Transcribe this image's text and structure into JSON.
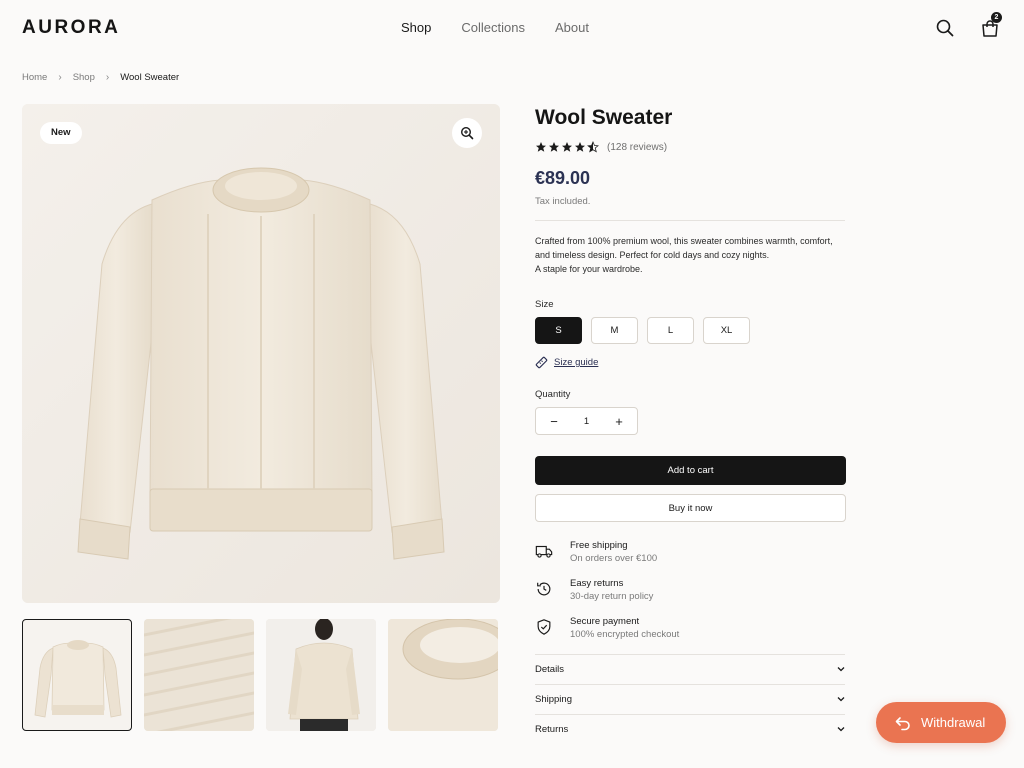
{
  "header": {
    "logo": "AURORA",
    "nav": [
      {
        "label": "Shop",
        "active": true
      },
      {
        "label": "Collections",
        "active": false
      },
      {
        "label": "About",
        "active": false
      }
    ],
    "search_icon": "search-icon",
    "bag_icon": "shopping-bag-icon",
    "bag_count": "2"
  },
  "breadcrumb": {
    "items": [
      "Home",
      "Shop"
    ],
    "current": "Wool Sweater"
  },
  "gallery": {
    "badge": "New",
    "zoom_icon": "zoom-in-icon",
    "thumbnails": [
      "front",
      "knit-detail",
      "model-back",
      "collar-detail"
    ],
    "selected_thumbnail": 0
  },
  "product": {
    "title": "Wool Sweater",
    "rating": 4.5,
    "reviews": "(128 reviews)",
    "price": "€89.00",
    "tax_note": "Tax included.",
    "description": [
      "Crafted from 100% premium wool, this sweater combines warmth, comfort,",
      "and timeless design. Perfect for cold days and cozy nights.",
      "A staple for your wardrobe."
    ]
  },
  "size": {
    "label": "Size",
    "options": [
      "S",
      "M",
      "L",
      "XL"
    ],
    "selected": "S",
    "guide": "Size guide"
  },
  "quantity": {
    "label": "Quantity",
    "value": "1",
    "minus": "−",
    "plus": "+"
  },
  "actions": {
    "add_to_cart": "Add to cart",
    "buy_now": "Buy it now"
  },
  "perks": [
    {
      "icon": "truck-icon",
      "title": "Free shipping",
      "subtitle": "On orders over €100"
    },
    {
      "icon": "history-icon",
      "title": "Easy returns",
      "subtitle": "30-day return policy"
    },
    {
      "icon": "shield-check-icon",
      "title": "Secure payment",
      "subtitle": "100% encrypted checkout"
    }
  ],
  "accordion": [
    "Details",
    "Shipping",
    "Returns"
  ],
  "withdrawal": {
    "label": "Withdrawal",
    "icon": "undo-arrow-icon"
  },
  "colors": {
    "accent_orange": "#ea7451",
    "price_navy": "#2b3253",
    "primary_black": "#151515",
    "image_bg": "#f2eee9"
  }
}
